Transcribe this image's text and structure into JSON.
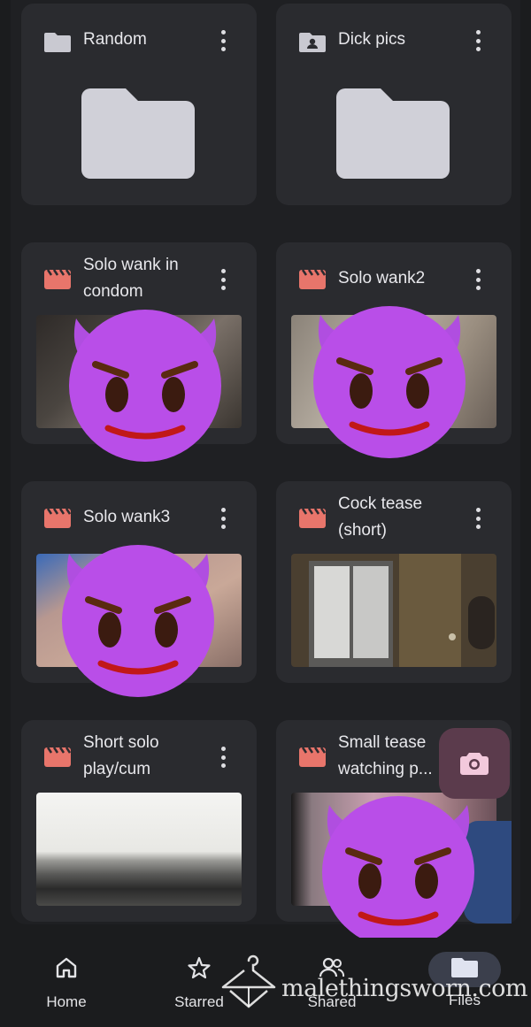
{
  "files": [
    {
      "title_line1": "Random",
      "title_line2": "",
      "type": "folder",
      "folder_icon": "folder-icon"
    },
    {
      "title_line1": "Dick pics",
      "title_line2": "",
      "type": "folder",
      "folder_icon": "shared-folder-icon"
    },
    {
      "title_line1": "Solo wank in",
      "title_line2": "condom",
      "type": "video"
    },
    {
      "title_line1": "Solo wank2",
      "title_line2": "",
      "type": "video"
    },
    {
      "title_line1": "Solo wank3",
      "title_line2": "",
      "type": "video"
    },
    {
      "title_line1": "Cock tease",
      "title_line2": "(short)",
      "type": "video"
    },
    {
      "title_line1": "Short solo",
      "title_line2": "play/cum",
      "type": "video"
    },
    {
      "title_line1": "Small tease",
      "title_line2": "watching p...",
      "type": "video"
    }
  ],
  "fab": {
    "icon": "camera-icon"
  },
  "nav": {
    "home": "Home",
    "starred": "Starred",
    "shared": "Shared",
    "files": "Files",
    "active": "files"
  },
  "watermark": {
    "text": "malethingsworn.com"
  },
  "colors": {
    "background": "#1b1c1e",
    "card": "#2a2b2f",
    "video_icon": "#e8756b",
    "folder_icon": "#c9c9d1",
    "fab": "#5b3b4c",
    "emoji": "#b44ee8"
  }
}
